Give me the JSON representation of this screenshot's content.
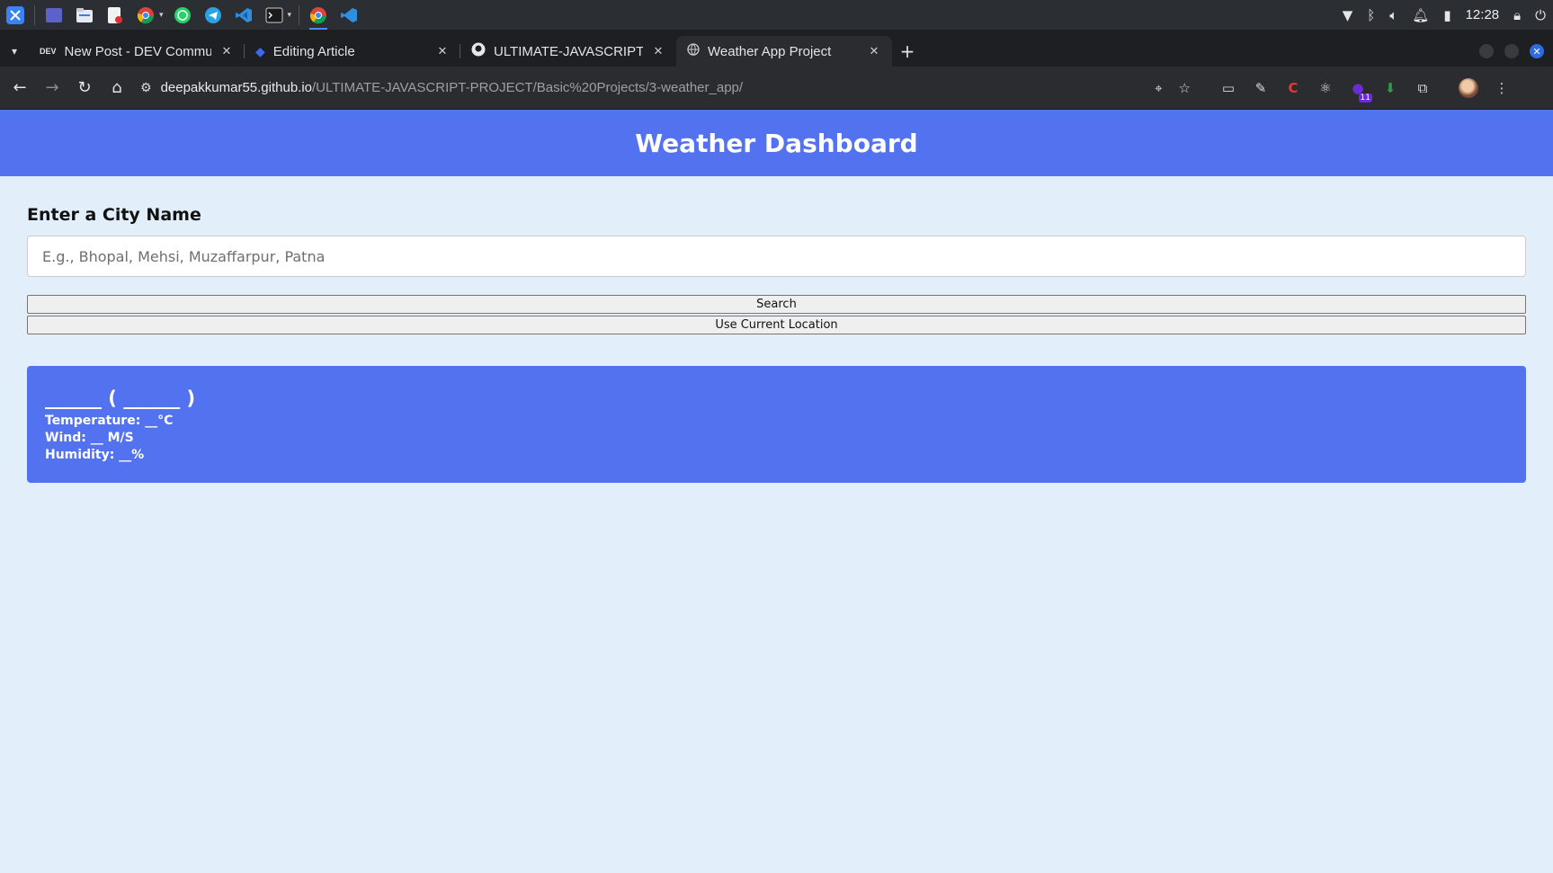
{
  "taskbar": {
    "apps": [
      "kde-launcher-icon",
      "desktop-pager-icon",
      "file-manager-icon",
      "text-editor-icon",
      "chrome-icon",
      "whatsapp-icon",
      "telegram-icon",
      "vscode-icon",
      "terminal-icon",
      "chrome-icon",
      "vscode-icon"
    ],
    "clock": "12:28"
  },
  "browser": {
    "tabs": [
      {
        "label": "New Post - DEV Commu",
        "favicon": "DEV"
      },
      {
        "label": "Editing Article"
      },
      {
        "label": "ULTIMATE-JAVASCRIPT-"
      },
      {
        "label": "Weather App Project"
      }
    ],
    "url": {
      "host": "deepakkumar55.github.io",
      "path": "/ULTIMATE-JAVASCRIPT-PROJECT/Basic%20Projects/3-weather_app/"
    },
    "extension_badge": "11"
  },
  "page": {
    "title": "Weather Dashboard",
    "city_label": "Enter a City Name",
    "city_placeholder": "E.g., Bhopal, Mehsi, Muzaffarpur, Patna",
    "search_button": "Search",
    "location_button": "Use Current Location",
    "weather": {
      "heading": "______ ( ______ )",
      "temperature": "Temperature: __°C",
      "wind": "Wind: __ M/S",
      "humidity": "Humidity: __%"
    }
  },
  "colors": {
    "accent": "#5372f0",
    "page_background": "#e2effa"
  }
}
